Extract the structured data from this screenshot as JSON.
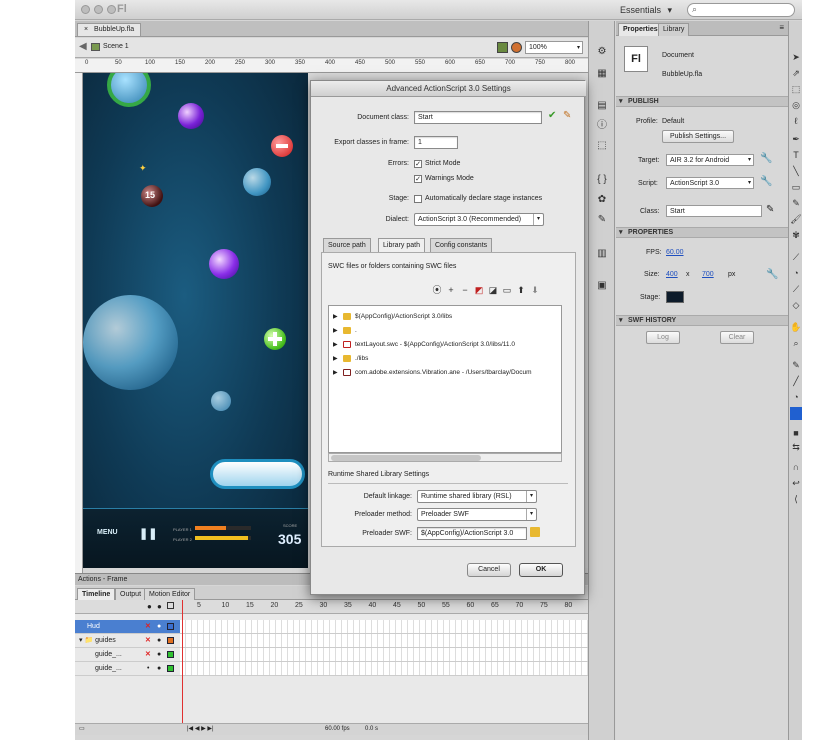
{
  "app": {
    "logo": "Fl",
    "workspace": "Essentials",
    "workspace_caret": "▾",
    "search_placeholder": ""
  },
  "document": {
    "tab": "BubbleUp.fla",
    "scene": "Scene 1",
    "zoom": "100%"
  },
  "ruler": [
    "0",
    "50",
    "100",
    "150",
    "200",
    "250",
    "300",
    "350",
    "400",
    "450",
    "500",
    "550",
    "600",
    "650",
    "700",
    "750",
    "800"
  ],
  "game_hud": {
    "menu": "MENU",
    "player1": "PLAYER 1",
    "player2": "PLAYER 2",
    "score_label": "SCORE",
    "score": "305",
    "bomb_number": "15"
  },
  "actions_panel": "Actions - Frame",
  "timeline": {
    "tabs": [
      "Timeline",
      "Output",
      "Motion Editor"
    ],
    "frame_numbers": [
      "5",
      "10",
      "15",
      "20",
      "25",
      "30",
      "35",
      "40",
      "45",
      "50",
      "55",
      "60",
      "65",
      "70",
      "75",
      "80"
    ],
    "layers": [
      {
        "name": "Hud"
      },
      {
        "name": "guides"
      },
      {
        "name": "guide_..."
      },
      {
        "name": "guide_..."
      }
    ],
    "fps": "60.00 fps",
    "time": "0.0 s"
  },
  "properties": {
    "tabs": [
      "Properties",
      "Library"
    ],
    "doc_icon": "Fl",
    "doc_type": "Document",
    "doc_name": "BubbleUp.fla",
    "publish_section": "PUBLISH",
    "profile_label": "Profile:",
    "profile_value": "Default",
    "publish_settings_btn": "Publish Settings...",
    "target_label": "Target:",
    "target_value": "AIR 3.2 for Android",
    "script_label": "Script:",
    "script_value": "ActionScript 3.0",
    "class_label": "Class:",
    "class_value": "Start",
    "properties_section": "PROPERTIES",
    "fps_label": "FPS:",
    "fps_value": "60.00",
    "size_label": "Size:",
    "width": "400",
    "x": "x",
    "height": "700",
    "px": "px",
    "stage_label": "Stage:",
    "stage_color": "#0d1b2a",
    "swf_history_section": "SWF HISTORY",
    "log_btn": "Log",
    "clear_btn": "Clear"
  },
  "dialog": {
    "title": "Advanced ActionScript 3.0 Settings",
    "document_class_label": "Document class:",
    "document_class_value": "Start",
    "export_label": "Export classes in frame:",
    "export_value": "1",
    "errors_label": "Errors:",
    "strict_mode": "Strict Mode",
    "warnings_mode": "Warnings Mode",
    "stage_label": "Stage:",
    "auto_declare": "Automatically declare stage instances",
    "dialect_label": "Dialect:",
    "dialect_value": "ActionScript 3.0 (Recommended)",
    "tabs": [
      "Source path",
      "Library path",
      "Config constants"
    ],
    "swc_heading": "SWC files or folders containing SWC files",
    "library_items": [
      {
        "label": "$(AppConfig)/ActionScript 3.0/libs",
        "icon": "folder"
      },
      {
        "label": ".",
        "icon": "folder"
      },
      {
        "label": "textLayout.swc - $(AppConfig)/ActionScript 3.0/libs/11.0",
        "icon": "swc"
      },
      {
        "label": "./libs",
        "icon": "folder"
      },
      {
        "label": "com.adobe.extensions.Vibration.ane - /Users/tbarclay/Docum",
        "icon": "ane"
      }
    ],
    "rsl_heading": "Runtime Shared Library Settings",
    "default_linkage_label": "Default linkage:",
    "default_linkage_value": "Runtime shared library (RSL)",
    "preloader_method_label": "Preloader method:",
    "preloader_method_value": "Preloader SWF",
    "preloader_swf_label": "Preloader SWF:",
    "preloader_swf_value": "$(AppConfig)/ActionScript 3.0",
    "cancel": "Cancel",
    "ok": "OK"
  },
  "colors": {
    "accent_check": "#3a9a2a",
    "timeline_selected": "#4a7fd0",
    "player_bar_orange": "#f08020",
    "player_bar_yellow": "#f0c020"
  }
}
